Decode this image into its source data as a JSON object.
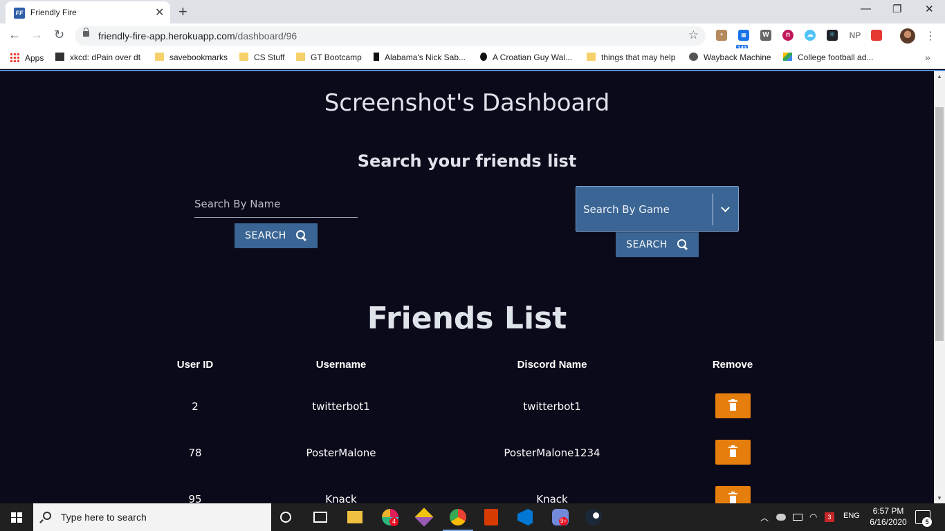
{
  "browser": {
    "tab_title": "Friendly Fire",
    "tab_favicon": "FF",
    "url_host": "friendly-fire-app.herokuapp.com",
    "url_path": "/dashboard/96",
    "extensions": [
      "143",
      "W",
      "NP"
    ],
    "bookmarks": [
      "Apps",
      "xkcd: dPain over dt",
      "savebookmarks",
      "CS Stuff",
      "GT Bootcamp",
      "Alabama's Nick Sab...",
      "A Croatian Guy Wal...",
      "things that may help",
      "Wayback Machine",
      "College football ad..."
    ]
  },
  "page": {
    "dashboard_title": "Screenshot's Dashboard",
    "search_heading": "Search your friends list",
    "name_search": {
      "placeholder": "Search By Name",
      "button_label": "SEARCH"
    },
    "game_search": {
      "selected": "Search By Game",
      "button_label": "SEARCH"
    },
    "friends_title": "Friends List",
    "table": {
      "headers": {
        "user_id": "User ID",
        "username": "Username",
        "discord": "Discord Name",
        "remove": "Remove"
      },
      "rows": [
        {
          "user_id": "2",
          "username": "twitterbot1",
          "discord": "twitterbot1"
        },
        {
          "user_id": "78",
          "username": "PosterMalone",
          "discord": "PosterMalone1234"
        },
        {
          "user_id": "95",
          "username": "Knack",
          "discord": "Knack"
        }
      ]
    },
    "colors": {
      "background": "#0b0a1a",
      "primary": "#3a6594",
      "danger": "#e67e0e"
    }
  },
  "taskbar": {
    "search_placeholder": "Type here to search",
    "badges": {
      "slack": "4",
      "discord": "9+",
      "mail": "3",
      "notifications": "5"
    },
    "lang": "ENG",
    "time": "6:57 PM",
    "date": "6/16/2020"
  }
}
